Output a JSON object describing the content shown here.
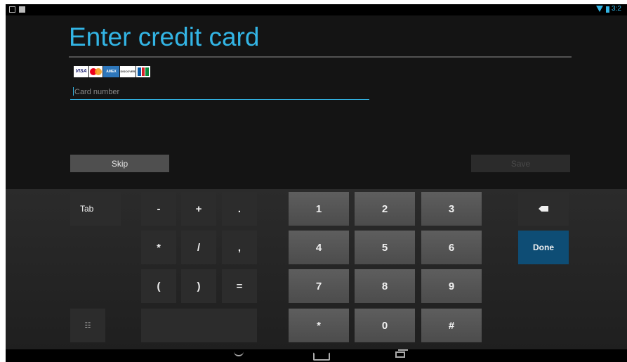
{
  "status_bar": {
    "left_icons": [
      "gallery-icon",
      "screenshot-icon"
    ],
    "wifi_icon": "wifi-icon",
    "battery_icon": "battery-icon",
    "clock": "3:2"
  },
  "form": {
    "title": "Enter credit card",
    "card_brands": [
      "VISA",
      "MasterCard",
      "AMEX",
      "DISCOVER",
      "JCB"
    ],
    "card_number": {
      "placeholder": "Card number",
      "value": ""
    },
    "skip_label": "Skip",
    "save_label": "Save"
  },
  "keyboard": {
    "tab": "Tab",
    "symbols": [
      "-",
      "+",
      ".",
      "*",
      "/",
      ",",
      "(",
      ")",
      "="
    ],
    "digits": [
      "1",
      "2",
      "3",
      "4",
      "5",
      "6",
      "7",
      "8",
      "9",
      "*",
      "0",
      "#"
    ],
    "done": "Done",
    "delete_icon": "backspace-icon",
    "settings_icon": "keyboard-settings-icon"
  },
  "nav_bar": {
    "back_icon": "back-chevron-icon",
    "home_icon": "home-icon",
    "recent_icon": "recent-apps-icon"
  },
  "colors": {
    "accent": "#33b5e5",
    "done_key": "#0e4d75",
    "background": "#141414"
  }
}
